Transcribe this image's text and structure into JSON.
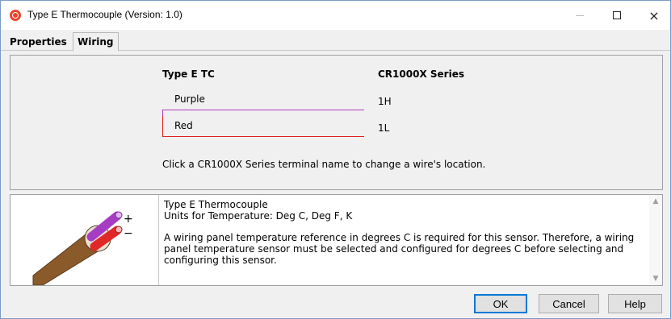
{
  "window": {
    "title": "Type E Thermocouple (Version: 1.0)",
    "icon": "app-logo-icon",
    "controls": {
      "minimize": "minimize-icon",
      "maximize": "maximize-icon",
      "close": "×"
    }
  },
  "tabs": [
    {
      "label": "Properties",
      "active": false
    },
    {
      "label": "Wiring",
      "active": true
    }
  ],
  "wiring": {
    "sensor_header": "Type E TC",
    "datalogger_header": "CR1000X Series",
    "wires": [
      {
        "label": "Purple",
        "terminal": "1H",
        "color": "#b03cb8"
      },
      {
        "label": "Red",
        "terminal": "1L",
        "color": "#e02020"
      }
    ],
    "hint": "Click a CR1000X Series terminal name to change a wire's location."
  },
  "description": {
    "lines": [
      "Type E Thermocouple",
      "Units for Temperature: Deg C, Deg F, K",
      "A wiring panel temperature reference in degrees C is required for this sensor. Therefore, a wiring panel temperature sensor must be selected and configured for degrees C before selecting and configuring this sensor."
    ],
    "image": "thermocouple-wire-icon",
    "image_symbols": {
      "plus": "+",
      "minus": "−"
    }
  },
  "buttons": {
    "ok": "OK",
    "cancel": "Cancel",
    "help": "Help"
  }
}
